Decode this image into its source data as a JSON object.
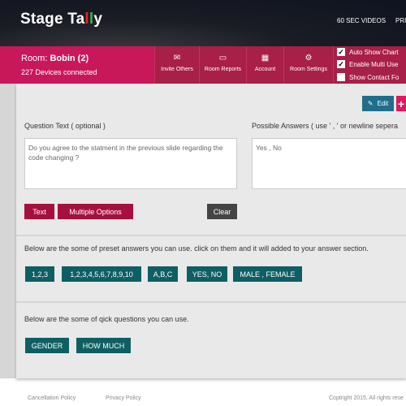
{
  "header": {
    "logo": "Stage Tally",
    "nav": [
      "60 SEC VIDEOS",
      "PRI"
    ]
  },
  "room": {
    "label": "Room:",
    "name": "Bobin (2)",
    "devices": "227 Devices connected"
  },
  "nav": [
    {
      "label": "Invite Others",
      "icon": "invite-icon"
    },
    {
      "label": "Room Reports",
      "icon": "monitor-chart-icon"
    },
    {
      "label": "Account",
      "icon": "building-icon"
    },
    {
      "label": "Room Settings",
      "icon": "gears-icon"
    }
  ],
  "options": [
    {
      "label": "Auto Show Chart",
      "checked": true
    },
    {
      "label": "Enable Multi Use",
      "checked": true
    },
    {
      "label": "Show Contact Fo",
      "checked": false
    }
  ],
  "toolbar": {
    "edit": "Edit",
    "add": "+"
  },
  "question": {
    "label": "Question Text ( optional )",
    "value": "Do you agree to the statment in the previous slide regarding the code changing ?"
  },
  "answers": {
    "label": "Possible Answers ( use ' , ' or newline sepera",
    "value": "Yes , No"
  },
  "types": {
    "text": "Text",
    "multiple": "Multiple  Options",
    "clear": "Clear"
  },
  "presets": {
    "intro": "Below are the some of preset answers you can use. click on them and it will added to your answer section.",
    "items": [
      "1,2,3",
      "1,2,3,4,5,6,7,8,9,10",
      "A,B,C",
      "YES, NO",
      "MALE , FEMALE"
    ]
  },
  "quick": {
    "intro": "Below are the some of qick questions you can use.",
    "items": [
      "GENDER",
      "HOW MUCH"
    ]
  },
  "footer": {
    "cancel": "Cancellation Policy",
    "privacy": "Privacy Policy",
    "copyright": "Coptright 2015,  All rights rese"
  },
  "colors": {
    "brand": "#c8185a",
    "nav": "#a81f48",
    "teal": "#0e5f63",
    "edit": "#1f6e8c"
  }
}
